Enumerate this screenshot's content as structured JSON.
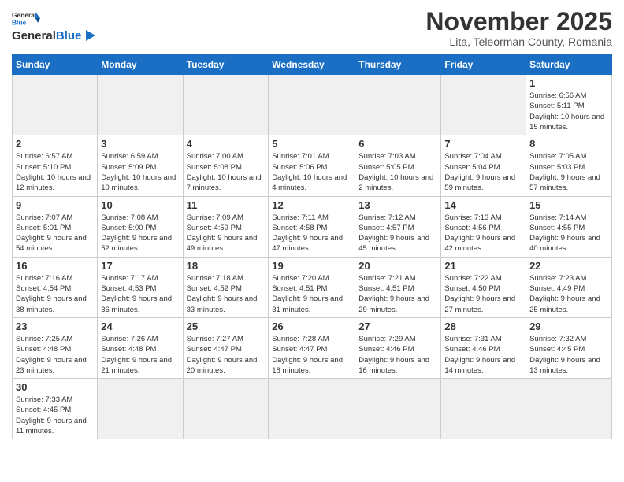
{
  "header": {
    "logo_general": "General",
    "logo_blue": "Blue",
    "month_title": "November 2025",
    "subtitle": "Lita, Teleorman County, Romania"
  },
  "days_of_week": [
    "Sunday",
    "Monday",
    "Tuesday",
    "Wednesday",
    "Thursday",
    "Friday",
    "Saturday"
  ],
  "weeks": [
    [
      {
        "day": "",
        "info": ""
      },
      {
        "day": "",
        "info": ""
      },
      {
        "day": "",
        "info": ""
      },
      {
        "day": "",
        "info": ""
      },
      {
        "day": "",
        "info": ""
      },
      {
        "day": "",
        "info": ""
      },
      {
        "day": "1",
        "info": "Sunrise: 6:56 AM\nSunset: 5:11 PM\nDaylight: 10 hours\nand 15 minutes."
      }
    ],
    [
      {
        "day": "2",
        "info": "Sunrise: 6:57 AM\nSunset: 5:10 PM\nDaylight: 10 hours\nand 12 minutes."
      },
      {
        "day": "3",
        "info": "Sunrise: 6:59 AM\nSunset: 5:09 PM\nDaylight: 10 hours\nand 10 minutes."
      },
      {
        "day": "4",
        "info": "Sunrise: 7:00 AM\nSunset: 5:08 PM\nDaylight: 10 hours\nand 7 minutes."
      },
      {
        "day": "5",
        "info": "Sunrise: 7:01 AM\nSunset: 5:06 PM\nDaylight: 10 hours\nand 4 minutes."
      },
      {
        "day": "6",
        "info": "Sunrise: 7:03 AM\nSunset: 5:05 PM\nDaylight: 10 hours\nand 2 minutes."
      },
      {
        "day": "7",
        "info": "Sunrise: 7:04 AM\nSunset: 5:04 PM\nDaylight: 9 hours\nand 59 minutes."
      },
      {
        "day": "8",
        "info": "Sunrise: 7:05 AM\nSunset: 5:03 PM\nDaylight: 9 hours\nand 57 minutes."
      }
    ],
    [
      {
        "day": "9",
        "info": "Sunrise: 7:07 AM\nSunset: 5:01 PM\nDaylight: 9 hours\nand 54 minutes."
      },
      {
        "day": "10",
        "info": "Sunrise: 7:08 AM\nSunset: 5:00 PM\nDaylight: 9 hours\nand 52 minutes."
      },
      {
        "day": "11",
        "info": "Sunrise: 7:09 AM\nSunset: 4:59 PM\nDaylight: 9 hours\nand 49 minutes."
      },
      {
        "day": "12",
        "info": "Sunrise: 7:11 AM\nSunset: 4:58 PM\nDaylight: 9 hours\nand 47 minutes."
      },
      {
        "day": "13",
        "info": "Sunrise: 7:12 AM\nSunset: 4:57 PM\nDaylight: 9 hours\nand 45 minutes."
      },
      {
        "day": "14",
        "info": "Sunrise: 7:13 AM\nSunset: 4:56 PM\nDaylight: 9 hours\nand 42 minutes."
      },
      {
        "day": "15",
        "info": "Sunrise: 7:14 AM\nSunset: 4:55 PM\nDaylight: 9 hours\nand 40 minutes."
      }
    ],
    [
      {
        "day": "16",
        "info": "Sunrise: 7:16 AM\nSunset: 4:54 PM\nDaylight: 9 hours\nand 38 minutes."
      },
      {
        "day": "17",
        "info": "Sunrise: 7:17 AM\nSunset: 4:53 PM\nDaylight: 9 hours\nand 36 minutes."
      },
      {
        "day": "18",
        "info": "Sunrise: 7:18 AM\nSunset: 4:52 PM\nDaylight: 9 hours\nand 33 minutes."
      },
      {
        "day": "19",
        "info": "Sunrise: 7:20 AM\nSunset: 4:51 PM\nDaylight: 9 hours\nand 31 minutes."
      },
      {
        "day": "20",
        "info": "Sunrise: 7:21 AM\nSunset: 4:51 PM\nDaylight: 9 hours\nand 29 minutes."
      },
      {
        "day": "21",
        "info": "Sunrise: 7:22 AM\nSunset: 4:50 PM\nDaylight: 9 hours\nand 27 minutes."
      },
      {
        "day": "22",
        "info": "Sunrise: 7:23 AM\nSunset: 4:49 PM\nDaylight: 9 hours\nand 25 minutes."
      }
    ],
    [
      {
        "day": "23",
        "info": "Sunrise: 7:25 AM\nSunset: 4:48 PM\nDaylight: 9 hours\nand 23 minutes."
      },
      {
        "day": "24",
        "info": "Sunrise: 7:26 AM\nSunset: 4:48 PM\nDaylight: 9 hours\nand 21 minutes."
      },
      {
        "day": "25",
        "info": "Sunrise: 7:27 AM\nSunset: 4:47 PM\nDaylight: 9 hours\nand 20 minutes."
      },
      {
        "day": "26",
        "info": "Sunrise: 7:28 AM\nSunset: 4:47 PM\nDaylight: 9 hours\nand 18 minutes."
      },
      {
        "day": "27",
        "info": "Sunrise: 7:29 AM\nSunset: 4:46 PM\nDaylight: 9 hours\nand 16 minutes."
      },
      {
        "day": "28",
        "info": "Sunrise: 7:31 AM\nSunset: 4:46 PM\nDaylight: 9 hours\nand 14 minutes."
      },
      {
        "day": "29",
        "info": "Sunrise: 7:32 AM\nSunset: 4:45 PM\nDaylight: 9 hours\nand 13 minutes."
      }
    ],
    [
      {
        "day": "30",
        "info": "Sunrise: 7:33 AM\nSunset: 4:45 PM\nDaylight: 9 hours\nand 11 minutes."
      },
      {
        "day": "",
        "info": ""
      },
      {
        "day": "",
        "info": ""
      },
      {
        "day": "",
        "info": ""
      },
      {
        "day": "",
        "info": ""
      },
      {
        "day": "",
        "info": ""
      },
      {
        "day": "",
        "info": ""
      }
    ]
  ]
}
